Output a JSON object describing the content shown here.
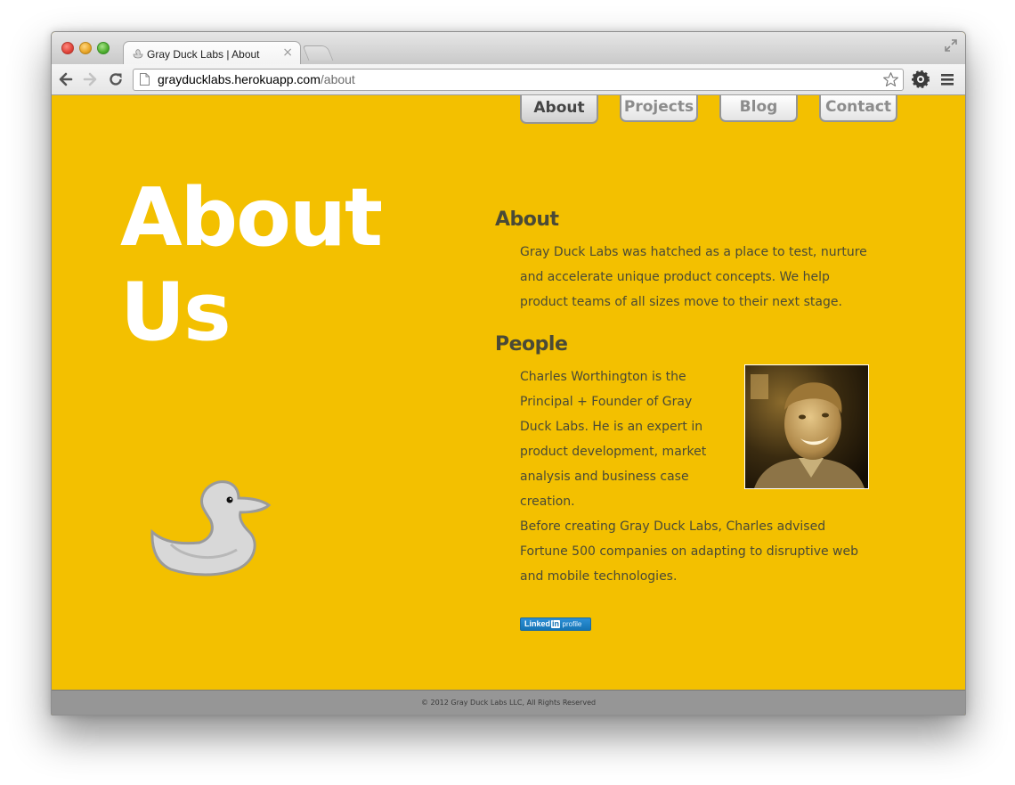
{
  "browser": {
    "tab_title": "Gray Duck Labs | About",
    "tab_close": "×",
    "tab_favicon": "duck-favicon",
    "url_host": "grayducklabs.herokuapp.com",
    "url_path": "/about",
    "icons": [
      "back-arrow-icon",
      "forward-arrow-icon",
      "reload-icon",
      "page-icon",
      "star-icon",
      "settings-icon",
      "menu-icon",
      "expand-icon"
    ]
  },
  "nav": {
    "items": [
      {
        "label": "About",
        "active": true
      },
      {
        "label": "Projects",
        "active": false
      },
      {
        "label": "Blog",
        "active": false
      },
      {
        "label": "Contact",
        "active": false
      }
    ]
  },
  "hero": {
    "title_line1": "About",
    "title_line2": "Us"
  },
  "about": {
    "heading": "About",
    "text": "Gray Duck Labs was hatched as a place to test, nurture and accelerate unique product concepts. We help product teams of all sizes move to their next stage."
  },
  "people": {
    "heading": "People",
    "bio": "Charles Worthington is the Principal + Founder of Gray Duck Labs. He is an expert in product development, market analysis and business case creation.",
    "bio2": "Before creating Gray Duck Labs, Charles advised Fortune 500 companies on adapting to disruptive web and mobile technologies.",
    "photo_alt": "Charles Worthington"
  },
  "linkedin": {
    "word": "Linked",
    "in": "in",
    "profile": "profile"
  },
  "footer": {
    "text": "© 2012 Gray Duck Labs LLC, All Rights Reserved"
  },
  "colors": {
    "background": "#f3c000",
    "text": "#4a4a36",
    "hero": "#ffffff",
    "footer": "#969696"
  }
}
